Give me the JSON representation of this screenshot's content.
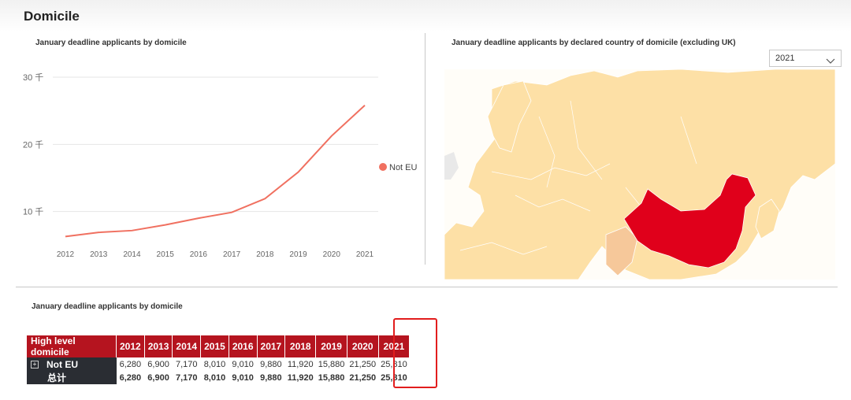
{
  "page": {
    "title": "Domicile"
  },
  "line_chart": {
    "title": "January deadline applicants  by domicile",
    "legend": "Not EU",
    "color": "#f07060"
  },
  "map_panel": {
    "title": "January deadline applicants  by declared country of domicile (excluding UK)",
    "year_select": {
      "value": "2021",
      "icon": "chevron-down-icon"
    },
    "colors": {
      "base": "#fde0a6",
      "highlight": "#e0001b",
      "medium": "#f6c89a"
    }
  },
  "table_panel": {
    "title": "January deadline applicants  by domicile",
    "headers": [
      "High level domicile",
      "2012",
      "2013",
      "2014",
      "2015",
      "2016",
      "2017",
      "2018",
      "2019",
      "2020",
      "2021"
    ],
    "rows": [
      {
        "label": "Not EU",
        "expand_icon": "plus-box-icon",
        "values": [
          "6,280",
          "6,900",
          "7,170",
          "8,010",
          "9,010",
          "9,880",
          "11,920",
          "15,880",
          "21,250",
          "25,810"
        ]
      }
    ],
    "total": {
      "label": "总计",
      "values": [
        "6,280",
        "6,900",
        "7,170",
        "8,010",
        "9,010",
        "9,880",
        "11,920",
        "15,880",
        "21,250",
        "25,810"
      ]
    },
    "header_color": "#b5141f",
    "highlight_color": "#e21d1d"
  },
  "chart_data": {
    "type": "line",
    "title": "January deadline applicants  by domicile",
    "xlabel": "",
    "ylabel": "",
    "x": [
      2012,
      2013,
      2014,
      2015,
      2016,
      2017,
      2018,
      2019,
      2020,
      2021
    ],
    "series": [
      {
        "name": "Not EU",
        "values": [
          6280,
          6900,
          7170,
          8010,
          9010,
          9880,
          11920,
          15880,
          21250,
          25810
        ]
      }
    ],
    "y_ticks": [
      {
        "value": 10000,
        "label": "10 千"
      },
      {
        "value": 20000,
        "label": "20 千"
      },
      {
        "value": 30000,
        "label": "30 千"
      }
    ],
    "ylim": [
      0,
      30000
    ],
    "grid": true,
    "legend": "right"
  }
}
